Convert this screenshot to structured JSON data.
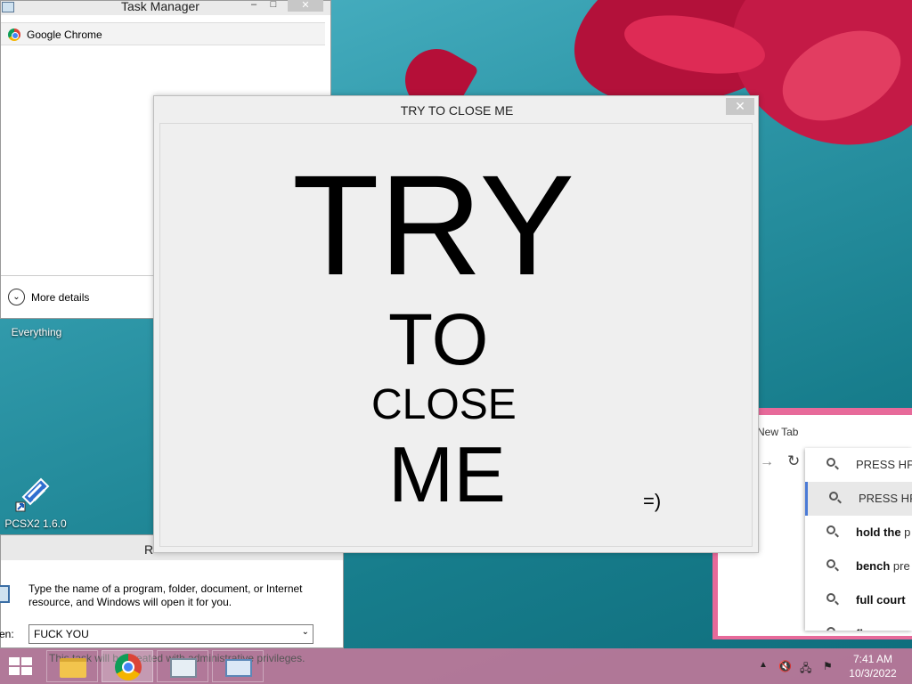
{
  "desktop": {
    "icons": [
      {
        "label": "Everything"
      },
      {
        "label": "PCSX2 1.6.0"
      }
    ]
  },
  "task_manager": {
    "title": "Task Manager",
    "controls": {
      "minimize": "–",
      "maximize": "□",
      "close": "✕"
    },
    "apps": [
      {
        "name": "Google Chrome"
      }
    ],
    "more_details_label": "More details"
  },
  "run_dialog": {
    "title_fragment": "R",
    "description": "Type the name of a program, folder, document, or Internet resource, and Windows will open it for you.",
    "open_label": "en:",
    "input_value": "FUCK YOU",
    "admin_note": "This task will be created with administrative privileges."
  },
  "popup": {
    "title": "TRY TO CLOSE ME",
    "close_glyph": "✕",
    "words": [
      "TRY",
      "TO",
      "CLOSE",
      "ME"
    ],
    "smiley": "=)"
  },
  "chrome": {
    "tab_title": "New Tab",
    "suggestions": [
      {
        "bold": "",
        "text": "PRESS HPP"
      },
      {
        "bold": "",
        "text": "PRESS HPP"
      },
      {
        "bold": "hold the",
        "text": " p"
      },
      {
        "bold": "bench",
        "text": " pre"
      },
      {
        "bold": "full court",
        "text": ""
      },
      {
        "bold": "flower",
        "text": " pre"
      }
    ]
  },
  "taskbar": {
    "pinned": [
      "file-explorer",
      "google-chrome",
      "task-manager",
      "run"
    ],
    "tray_chevron": "▲",
    "clock_time": "7:41 AM",
    "clock_date": "10/3/2022"
  },
  "colors": {
    "taskbar": "#cd789b",
    "chrome_frame": "#e76a9a",
    "wallpaper": "#2e97a8",
    "flower": "#c41a46"
  }
}
